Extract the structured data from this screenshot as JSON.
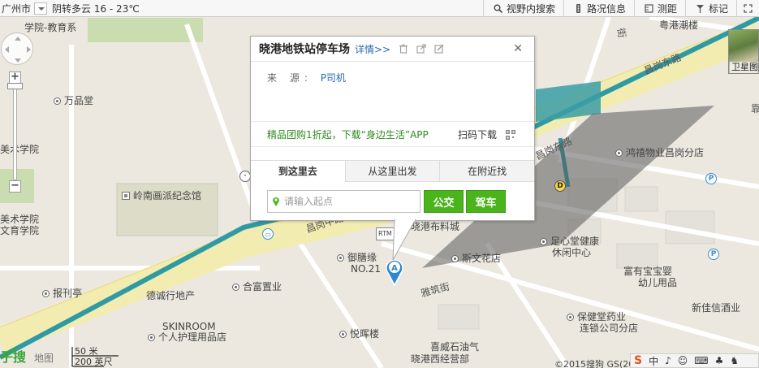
{
  "topbar": {
    "city": "广州市",
    "weather": "阴转多云 16 - 23℃",
    "tools": [
      {
        "label": "视野内搜索",
        "icon": "search-icon"
      },
      {
        "label": "路况信息",
        "icon": "traffic-light-icon"
      },
      {
        "label": "测距",
        "icon": "ruler-icon"
      },
      {
        "label": "标记",
        "icon": "flag-icon"
      }
    ]
  },
  "popup": {
    "title": "晓港地铁站停车场",
    "detail_link": "详情>>",
    "source_label": "来 源:",
    "source_value": "P司机",
    "promo_text": "精品团购1折起，下载“身边生活”APP",
    "qr_label": "扫码下载",
    "tabs": [
      "到这里去",
      "从这里出发",
      "在附近找"
    ],
    "active_tab": 0,
    "start_placeholder": "请输入起点",
    "bus_button": "公交",
    "car_button": "驾车"
  },
  "marker": {
    "letter": "A"
  },
  "map": {
    "poi": {
      "school_top": "学院-教育系",
      "wanpintang": "万品堂",
      "art_school": "美术学院",
      "lingnan": "岭南画派纪念馆",
      "art_school2": "美术学院",
      "art_school3": "文育学院",
      "yushanyuan": "御膳缘",
      "no21": "NO.21",
      "baokan": "报刊亭",
      "dechengxing": "德诚行地产",
      "hefu": "合富置业",
      "skinroom": "SKINROOM",
      "skinroom_cn": "个人护理用品店",
      "yuehui": "悦晖楼",
      "xiwei": "喜威石油气",
      "xiwei2": "晓港西经营部",
      "baojian": "保健堂药业",
      "baojian2": "连锁公司分店",
      "xinjia": "新佳信酒业",
      "fuyou": "富有宝宝婴",
      "fuyou2": "幼儿用品",
      "zuyunt": "足心堂健康",
      "zuyunt2": "休闲中心",
      "hongxi": "鸿禧物业昌岗分店",
      "siwen": "斯文花店",
      "xiaogang_bu": "晓港布料城",
      "yuegangchao": "粤港潮楼",
      "rtm": "RTM"
    },
    "roads": {
      "changgang_dong": "昌岗东路",
      "changgang_dong2": "昌岗东路",
      "changgang_mid": "昌岗中路",
      "yacheng": "雅筑街",
      "jie": "街",
      "kao": "靠"
    }
  },
  "satellite": {
    "label": "卫星图"
  },
  "bottom": {
    "logo": "子搜",
    "logo_map": "地图",
    "scale_m": "50 米",
    "scale_ft": "200 英尺",
    "copyright": "©2015搜狗 GS(20",
    "ime_items": [
      "中",
      "♪",
      "☺",
      "⌨",
      "♣",
      "♞"
    ]
  }
}
